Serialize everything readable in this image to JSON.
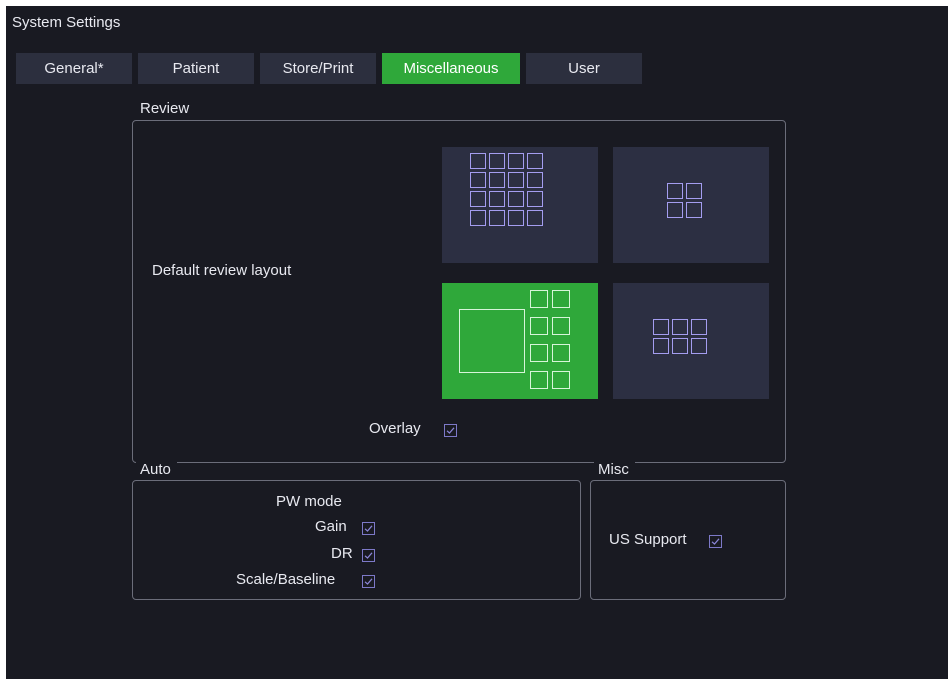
{
  "window": {
    "title": "System Settings"
  },
  "tabs": [
    {
      "label": "General*",
      "active": false
    },
    {
      "label": "Patient",
      "active": false
    },
    {
      "label": "Store/Print",
      "active": false
    },
    {
      "label": "Miscellaneous",
      "active": true
    },
    {
      "label": "User",
      "active": false
    }
  ],
  "review": {
    "title": "Review",
    "default_layout_label": "Default review layout",
    "layouts": [
      {
        "icon": "layout-4x4-grid-icon",
        "selected": false
      },
      {
        "icon": "layout-2x2-grid-icon",
        "selected": false
      },
      {
        "icon": "layout-1-large-8-small-icon",
        "selected": true
      },
      {
        "icon": "layout-3x2-grid-icon",
        "selected": false
      }
    ],
    "overlay_label": "Overlay",
    "overlay_checked": true
  },
  "auto": {
    "title": "Auto",
    "pw_mode_label": "PW mode",
    "gain_label": "Gain",
    "gain_checked": true,
    "dr_label": "DR",
    "dr_checked": true,
    "scale_baseline_label": "Scale/Baseline",
    "scale_baseline_checked": true
  },
  "misc": {
    "title": "Misc",
    "us_support_label": "US Support",
    "us_support_checked": true
  },
  "colors": {
    "background": "#191a22",
    "tab": "#2c2f3e",
    "accent_green": "#2fa83a",
    "layout_icon_stroke": "#a49df0"
  }
}
